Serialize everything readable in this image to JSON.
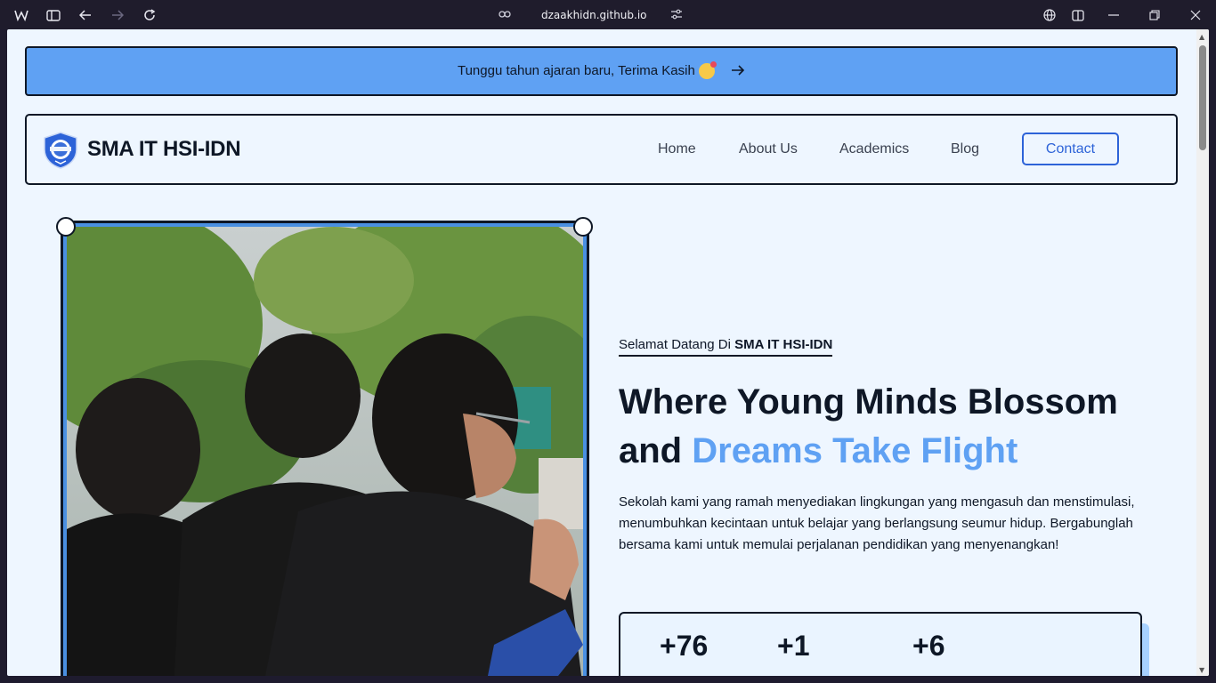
{
  "browser": {
    "url": "dzaakhidn.github.io"
  },
  "announcement": {
    "text": "Tunggu tahun ajaran baru, Terima Kasih"
  },
  "nav": {
    "brand": "SMA IT HSI-IDN",
    "links": [
      "Home",
      "About Us",
      "Academics",
      "Blog"
    ],
    "contact": "Contact"
  },
  "hero": {
    "eyebrow_prefix": "Selamat Datang Di ",
    "eyebrow_bold": "SMA IT HSI-IDN",
    "headline_line1": "Where Young Minds Blossom",
    "headline_and": "and ",
    "headline_accent": "Dreams Take Flight",
    "description": "Sekolah kami yang ramah menyediakan lingkungan yang mengasuh dan menstimulasi, menumbuhkan kecintaan untuk belajar yang berlangsung seumur hidup. Bergabunglah bersama kami untuk memulai perjalanan pendidikan yang menyenangkan!",
    "stats": [
      "+76",
      "+1",
      "+6"
    ]
  },
  "colors": {
    "accent": "#5fa1f3",
    "dark": "#0e1726",
    "page_bg": "#eef6ff",
    "contact": "#2d63d8"
  },
  "icons": {
    "browser": [
      "workspaces-icon",
      "sidebar-icon",
      "back-icon",
      "forward-icon",
      "refresh-icon",
      "link-icon",
      "site-settings-icon",
      "translate-icon",
      "split-view-icon",
      "minimize-icon",
      "restore-icon",
      "close-icon"
    ],
    "announcement": [
      "kiss-emoji-icon",
      "arrow-right-icon"
    ]
  }
}
